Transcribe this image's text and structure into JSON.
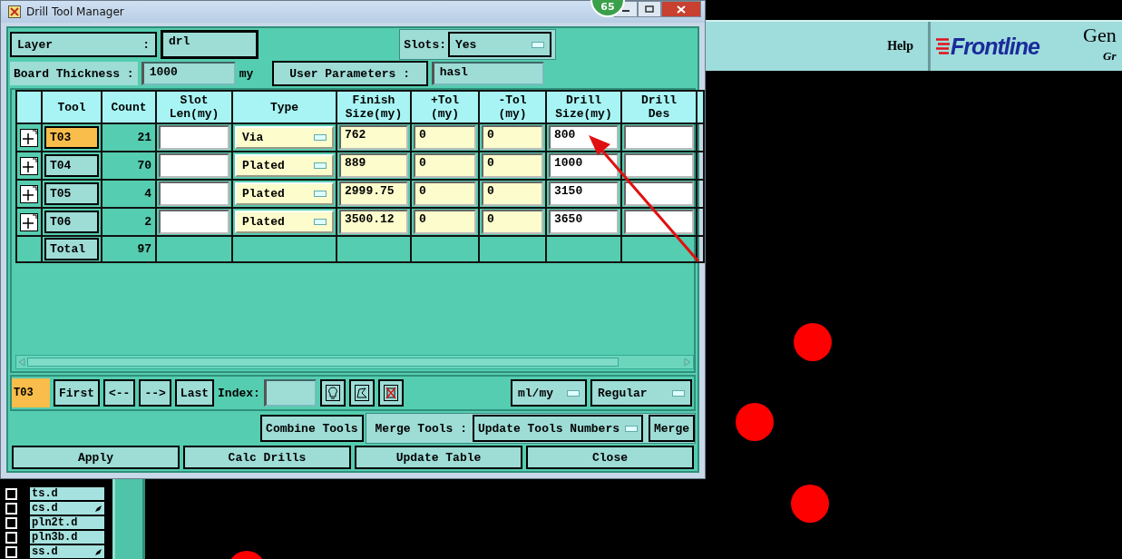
{
  "window": {
    "title": "Drill Tool Manager",
    "badge": "65"
  },
  "layer": {
    "label": "Layer",
    "separator": ":",
    "value": "drl"
  },
  "slots": {
    "label": "Slots:",
    "value": "Yes"
  },
  "board_thickness": {
    "label": "Board Thickness :",
    "value": "1000",
    "unit": "my"
  },
  "user_parameters": {
    "label": "User Parameters :",
    "value": "hasl"
  },
  "table": {
    "columns": [
      [
        "Tool"
      ],
      [
        "Count"
      ],
      [
        "Slot",
        "Len(my)"
      ],
      [
        "Type"
      ],
      [
        "Finish",
        "Size(my)"
      ],
      [
        "+Tol",
        "(my)"
      ],
      [
        "-Tol",
        "(my)"
      ],
      [
        "Drill",
        "Size(my)"
      ],
      [
        "Drill",
        "Des"
      ]
    ],
    "rows": [
      {
        "tool": "T03",
        "selected": true,
        "count": "21",
        "type": "Via",
        "finish": "762",
        "plus_tol": "0",
        "minus_tol": "0",
        "drill_size": "800"
      },
      {
        "tool": "T04",
        "selected": false,
        "count": "70",
        "type": "Plated",
        "finish": "889",
        "plus_tol": "0",
        "minus_tol": "0",
        "drill_size": "1000"
      },
      {
        "tool": "T05",
        "selected": false,
        "count": "4",
        "type": "Plated",
        "finish": "2999.75",
        "plus_tol": "0",
        "minus_tol": "0",
        "drill_size": "3150"
      },
      {
        "tool": "T06",
        "selected": false,
        "count": "2",
        "type": "Plated",
        "finish": "3500.12",
        "plus_tol": "0",
        "minus_tol": "0",
        "drill_size": "3650"
      }
    ],
    "total": {
      "label": "Total",
      "count": "97"
    }
  },
  "navigator": {
    "current": "T03",
    "buttons": [
      "First",
      "<--",
      "-->",
      "Last"
    ],
    "index_label": "Index:",
    "units": "ml/my",
    "mode": "Regular"
  },
  "merge": {
    "combine": "Combine Tools",
    "label": "Merge Tools :",
    "option": "Update Tools Numbers",
    "merge": "Merge"
  },
  "actions": [
    "Apply",
    "Calc Drills",
    "Update Table",
    "Close"
  ],
  "background": {
    "help": "Help",
    "logo": "Frontline",
    "product": "Gen",
    "subtitle": "Gr",
    "layers": [
      {
        "name": "ts.d",
        "checked": false,
        "marked": false
      },
      {
        "name": "cs.d",
        "checked": false,
        "marked": true
      },
      {
        "name": "pln2t.d",
        "checked": false,
        "marked": false
      },
      {
        "name": "pln3b.d",
        "checked": false,
        "marked": false
      },
      {
        "name": "ss.d",
        "checked": false,
        "marked": true
      }
    ]
  }
}
